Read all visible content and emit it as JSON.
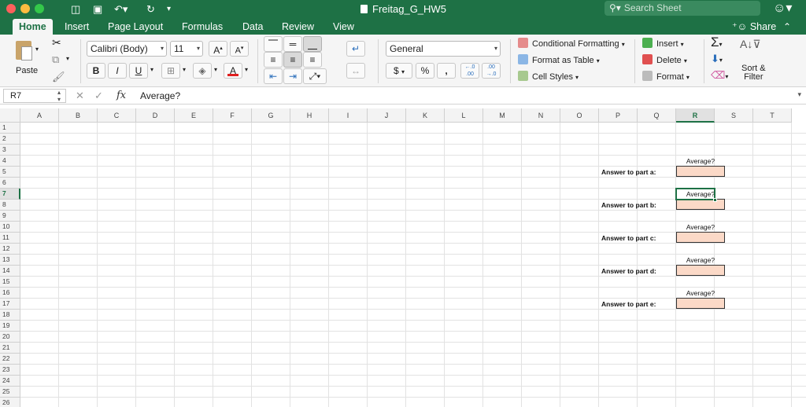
{
  "window": {
    "title": "Freitag_G_HW5",
    "search_placeholder": "Search Sheet",
    "traffic_colors": [
      "#fc605c",
      "#fdbc40",
      "#34c84a"
    ]
  },
  "tabs": [
    {
      "label": "Home",
      "active": true
    },
    {
      "label": "Insert",
      "active": false
    },
    {
      "label": "Page Layout",
      "active": false
    },
    {
      "label": "Formulas",
      "active": false
    },
    {
      "label": "Data",
      "active": false
    },
    {
      "label": "Review",
      "active": false
    },
    {
      "label": "View",
      "active": false
    }
  ],
  "share_label": "Share",
  "ribbon": {
    "paste_label": "Paste",
    "font_name": "Calibri (Body)",
    "font_size": "11",
    "bold": "B",
    "italic": "I",
    "underline": "U",
    "number_format": "General",
    "currency": "$",
    "percent": "%",
    "comma": ",",
    "inc_decimal": "←.0 .00",
    "dec_decimal": ".00 →.0",
    "conditional_formatting": "Conditional Formatting",
    "format_as_table": "Format as Table",
    "cell_styles": "Cell Styles",
    "insert": "Insert",
    "delete": "Delete",
    "format": "Format",
    "sort_filter_line1": "Sort &",
    "sort_filter_line2": "Filter",
    "font_color": "#e02020"
  },
  "formula_bar": {
    "name_box": "R7",
    "formula": "Average?"
  },
  "grid": {
    "columns": [
      "A",
      "B",
      "C",
      "D",
      "E",
      "F",
      "G",
      "H",
      "I",
      "J",
      "K",
      "L",
      "M",
      "N",
      "O",
      "P",
      "Q",
      "R",
      "S",
      "T"
    ],
    "rows": [
      "1",
      "2",
      "3",
      "4",
      "5",
      "6",
      "7",
      "8",
      "9",
      "10",
      "11",
      "12",
      "13",
      "14",
      "15",
      "16",
      "17",
      "18",
      "19",
      "20",
      "21",
      "22",
      "23",
      "24",
      "25",
      "26"
    ],
    "active_column": "R",
    "active_row": "7",
    "answer_fill": "#fbd9c7",
    "entries": [
      {
        "avg": "Average?",
        "label": "Answer to part a:"
      },
      {
        "avg": "Average?",
        "label": "Answer to part b:"
      },
      {
        "avg": "Average?",
        "label": "Answer to part c:"
      },
      {
        "avg": "Average?",
        "label": "Answer to part d:"
      },
      {
        "avg": "Average?",
        "label": "Answer to part e:"
      }
    ]
  }
}
